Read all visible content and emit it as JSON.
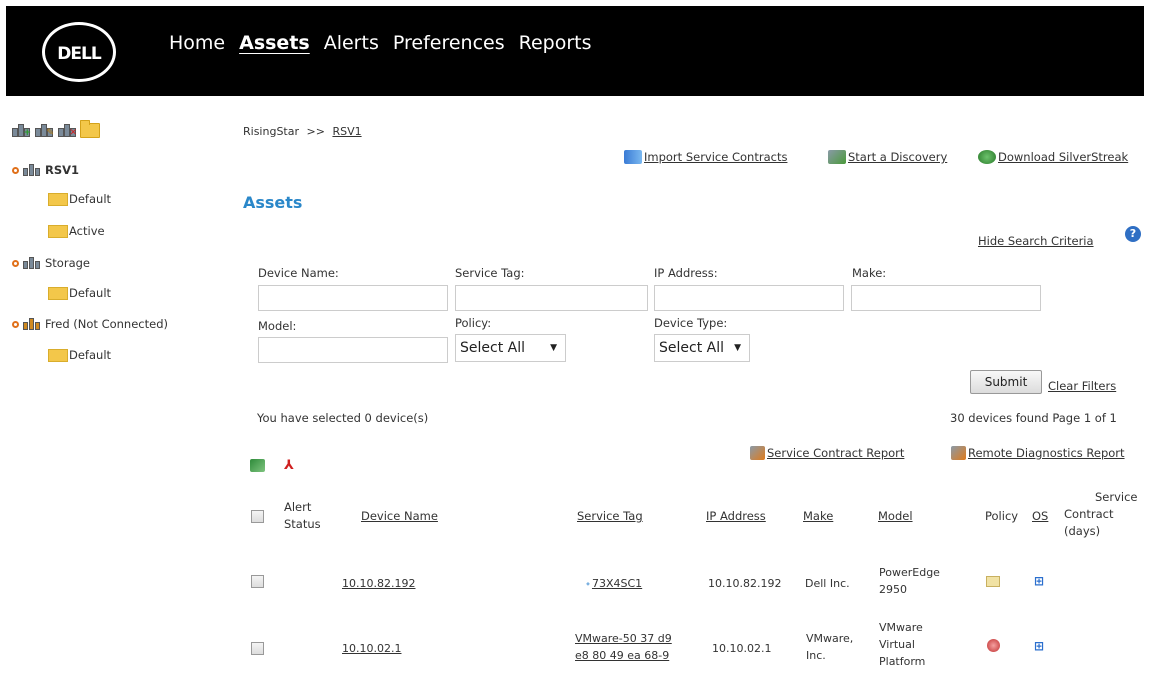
{
  "header": {
    "logo_text": "DELL",
    "nav": [
      "Home",
      "Assets",
      "Alerts",
      "Preferences",
      "Reports"
    ]
  },
  "sidebar": {
    "toolbar_badges": [
      "+",
      "✎",
      "✕"
    ],
    "tree": [
      {
        "label": "RSV1"
      },
      {
        "label": "Default"
      },
      {
        "label": "Active"
      },
      {
        "label": "Storage"
      },
      {
        "label": "Default"
      },
      {
        "label": "Fred (Not Connected)"
      },
      {
        "label": "Default"
      }
    ]
  },
  "breadcrumb": {
    "root": "RisingStar",
    "separator": ">>",
    "current": "RSV1"
  },
  "actions": {
    "import": "Import Service Contracts",
    "discovery": "Start a Discovery",
    "download": "Download SilverStreak"
  },
  "page_title": "Assets",
  "hide_search": "Hide Search Criteria",
  "help": "?",
  "filters": {
    "device_name": {
      "label": "Device Name:",
      "value": ""
    },
    "service_tag": {
      "label": "Service Tag:",
      "value": ""
    },
    "ip_address": {
      "label": "IP Address:",
      "value": ""
    },
    "make": {
      "label": "Make:",
      "value": ""
    },
    "model": {
      "label": "Model:",
      "value": ""
    },
    "policy": {
      "label": "Policy:",
      "selected": "Select All"
    },
    "device_type": {
      "label": "Device Type:",
      "selected": "Select All"
    }
  },
  "submit_label": "Submit",
  "clear_filters_label": "Clear Filters",
  "selected_text": "You have selected 0 device(s)",
  "found_text": "30 devices found Page 1 of 1",
  "reports": {
    "service_contract": "Service Contract Report",
    "remote_diagnostics": "Remote Diagnostics Report"
  },
  "table": {
    "headers": {
      "alert_status_1": "Alert",
      "alert_status_2": "Status",
      "device_name": "Device Name",
      "service_tag": "Service Tag",
      "ip_address": "IP Address",
      "make": "Make",
      "model": "Model",
      "policy": "Policy",
      "os": "OS",
      "contract_1": "Service",
      "contract_2": "Contract",
      "contract_3": "(days)"
    },
    "rows": [
      {
        "device_name": "10.10.82.192",
        "service_tag_1": "73X4SC1",
        "service_tag_2": "",
        "ip_address": "10.10.82.192",
        "make_1": "Dell Inc.",
        "make_2": "",
        "model_1": "PowerEdge",
        "model_2": "2950",
        "model_3": "",
        "policy_icon": "envelope-icon",
        "os_icon": "windows-icon"
      },
      {
        "device_name": "10.10.02.1",
        "service_tag_1": "VMware-50 37 d9",
        "service_tag_2": "e8 80 49 ea 68-9",
        "ip_address": "10.10.02.1",
        "make_1": "VMware,",
        "make_2": "Inc.",
        "model_1": "VMware",
        "model_2": "Virtual",
        "model_3": "Platform",
        "policy_icon": "red-policy-icon",
        "os_icon": "windows-icon"
      }
    ]
  },
  "colors": {
    "header_bg": "#000000",
    "title_blue": "#2a87c9",
    "folder_yellow": "#f3c74a",
    "bullet_orange": "#e0701a",
    "help_blue": "#2f6fc4"
  }
}
